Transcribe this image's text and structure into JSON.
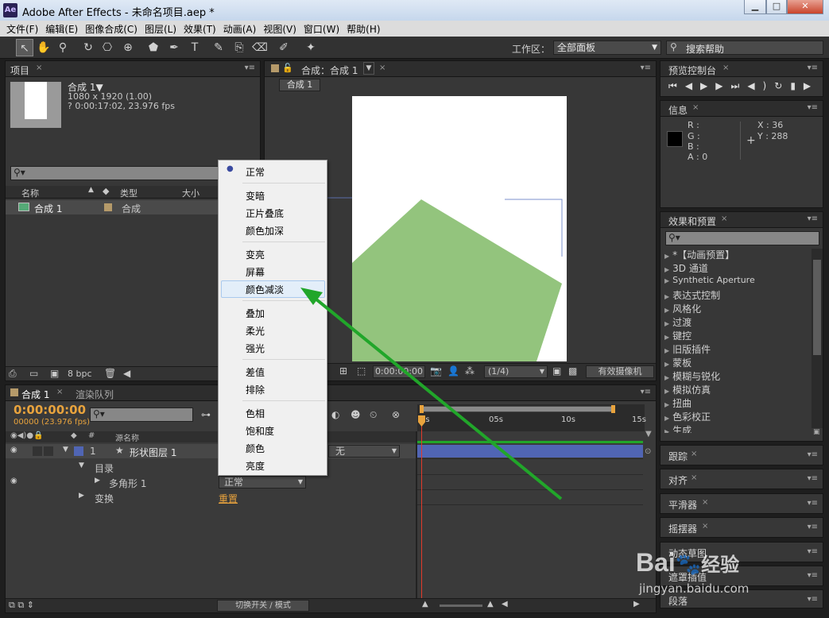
{
  "window": {
    "title": "Adobe After Effects - 未命名项目.aep *",
    "logo": "Ae",
    "min": "▁",
    "max": "□",
    "close": "✕"
  },
  "menu": [
    "文件(F)",
    "编辑(E)",
    "图像合成(C)",
    "图层(L)",
    "效果(T)",
    "动画(A)",
    "视图(V)",
    "窗口(W)",
    "帮助(H)"
  ],
  "toolbar": {
    "workspace_label": "工作区：",
    "workspace_value": "全部面板",
    "search_placeholder": "搜索帮助"
  },
  "project": {
    "tab": "项目",
    "comp_name": "合成 1▼",
    "comp_size": "1080 x 1920 (1.00)",
    "comp_duration": "? 0:00:17:02, 23.976 fps",
    "col_name": "名称",
    "col_type": "类型",
    "col_size": "大小",
    "item_name": "合成 1",
    "item_type": "合成",
    "bpc": "8 bpc"
  },
  "viewer": {
    "tab": "合成：合成 1",
    "sub_tab": "合成 1",
    "timecode": "0:00:00:00",
    "resolution": "(1/4)",
    "camera": "有效摄像机"
  },
  "preview": {
    "tab": "预览控制台"
  },
  "info": {
    "tab": "信息",
    "r": "R :",
    "g": "G :",
    "b": "B :",
    "a": "A : 0",
    "x": "X : 36",
    "y": "Y : 288"
  },
  "effects": {
    "tab": "效果和预置",
    "items": [
      "*【动画预置】",
      "3D 通道",
      "Synthetic Aperture",
      "表达式控制",
      "风格化",
      "过渡",
      "键控",
      "旧版插件",
      "蒙板",
      "模糊与锐化",
      "模拟仿真",
      "扭曲",
      "色彩校正",
      "生成"
    ]
  },
  "small_panels": [
    "跟踪",
    "对齐",
    "平滑器",
    "摇摆器",
    "动态草图",
    "遮罩插值",
    "段落"
  ],
  "timeline": {
    "tab": "合成 1",
    "tab2": "渲染队列",
    "timecode": "0:00:00:00",
    "fps": "00000 (23.976 fps)",
    "col_num": "#",
    "col_src": "源名称",
    "layer_num": "1",
    "layer_name": "形状图层 1",
    "layer_mode": "无",
    "row_content": "目录",
    "row_poly": "多角形 1",
    "row_poly_mode": "正常",
    "row_transform": "变换",
    "reset": "重置",
    "footer": "切换开关 / 模式",
    "ruler": [
      "0s",
      "05s",
      "10s",
      "15s"
    ]
  },
  "context_menu": {
    "items": [
      "正常",
      "变暗",
      "正片叠底",
      "颜色加深",
      "变亮",
      "屏幕",
      "颜色减淡",
      "叠加",
      "柔光",
      "强光",
      "差值",
      "排除",
      "色相",
      "饱和度",
      "颜色",
      "亮度"
    ],
    "selected": "正常",
    "highlighted": "颜色减淡"
  },
  "watermark": {
    "brand": "Bai",
    "brand2": "经验",
    "url": "jingyan.baidu.com"
  },
  "colors": {
    "shape_green": "#93c47d",
    "arrow_green": "#21a62a",
    "layer_bar": "#5065b4",
    "accent_orange": "#e8a33d",
    "ctx_highlight": "#e3eef9"
  }
}
